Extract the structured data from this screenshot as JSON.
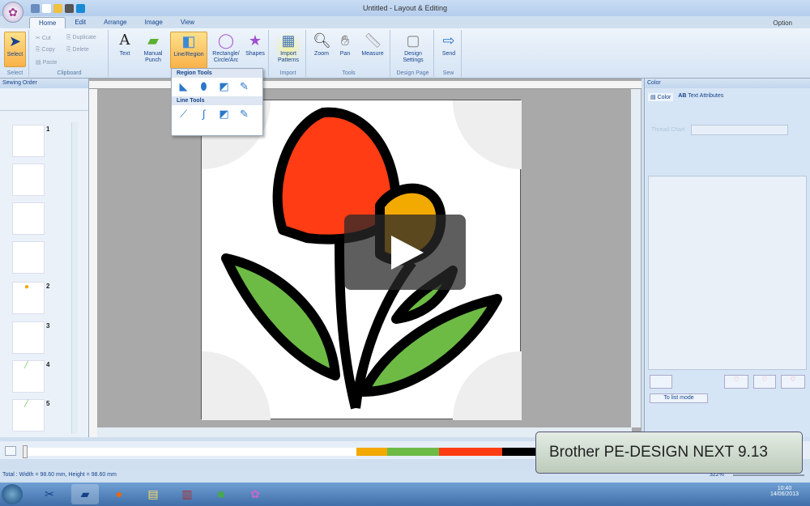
{
  "window": {
    "title": "Untitled - Layout & Editing",
    "option": "Option"
  },
  "tabs": [
    "Home",
    "Edit",
    "Arrange",
    "Image",
    "View"
  ],
  "ribbon": {
    "select": {
      "label": "Select",
      "group": "Select"
    },
    "clipboard": {
      "cut": "Cut",
      "copy": "Copy",
      "paste": "Paste",
      "duplicate": "Duplicate",
      "delete": "Delete",
      "group": "Clipboard"
    },
    "text": "Text",
    "manual_punch": "Manual Punch",
    "line_region": "Line/Region",
    "rect": "Rectangle/ Circle/Arc",
    "shapes": "Shapes",
    "import": {
      "label": "Import Patterns",
      "group": "Import"
    },
    "zoom": "Zoom",
    "pan": "Pan",
    "measure": "Measure",
    "tools_group": "Tools",
    "design_settings": {
      "label": "Design Settings",
      "group": "Design Page"
    },
    "send": {
      "label": "Send",
      "group": "Sew"
    }
  },
  "dropdown": {
    "region_tools": "Region Tools",
    "line_tools": "Line Tools"
  },
  "sewing_order": {
    "title": "Sewing Order",
    "numbers": [
      "1",
      "2",
      "3",
      "4",
      "5"
    ]
  },
  "color_panel": {
    "title": "Color",
    "tab_color": "Color",
    "tab_text": "Text Attributes",
    "thread_chart": "Thread Chart",
    "list_mode": "To list mode"
  },
  "color_bar": {
    "colors": [
      "#f2a900",
      "#6dbb45",
      "#ff3c14",
      "#000000"
    ]
  },
  "status": {
    "text": "Total : Width = 98.60 mm, Height = 98.60 mm",
    "zoom": "322%"
  },
  "overlay": "Brother PE-DESIGN NEXT 9.13",
  "taskbar": {
    "time": "10:40",
    "date": "14/06/2013"
  }
}
